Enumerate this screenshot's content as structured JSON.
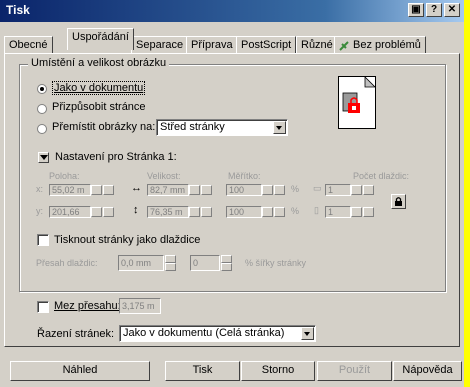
{
  "window": {
    "title": "Tisk",
    "buttons": [
      "▣",
      "?",
      "✕"
    ]
  },
  "tabs": [
    "Obecné",
    "Uspořádání",
    "Separace",
    "Příprava",
    "PostScript",
    "Různé",
    "Bez problémů"
  ],
  "active_tab": "Uspořádání",
  "group": {
    "label": "Umístění a velikost obrázku",
    "radio_as_document": "Jako v dokumentu",
    "radio_fit_page": "Přizpůsobit stránce",
    "radio_move": "Přemístit obrázky na:",
    "move_select": "Střed stránky",
    "settings_for": "Nastavení pro Stránka 1:",
    "col_position": "Poloha:",
    "col_size": "Velikost:",
    "col_scale": "Měřítko:",
    "col_tiles": "Počet dlaždic:",
    "x_label": "x:",
    "y_label": "y:",
    "x_value": "55,02 m",
    "y_value": "201,66",
    "w_value": "82,7 mm",
    "h_value": "76,35 m",
    "sx_value": "100",
    "sy_value": "100",
    "pct": "%",
    "tiles_x": "1",
    "tiles_y": "1",
    "tile_pages": "Tisknout stránky jako dlaždice",
    "tile_overlap_label": "Přesah dlaždic:",
    "tile_overlap_value": "0,0 mm",
    "tile_overlap_second": "0",
    "tile_overlap_width": "% šířky stránky"
  },
  "bleed": {
    "label": "Mez přesahu:",
    "value": "3,175 m"
  },
  "order": {
    "label": "Řazení stránek:",
    "value": "Jako v dokumentu (Celá stránka)"
  },
  "buttons": {
    "preview": "Náhled",
    "print": "Tisk",
    "cancel": "Storno",
    "apply": "Použít",
    "help": "Nápověda"
  }
}
